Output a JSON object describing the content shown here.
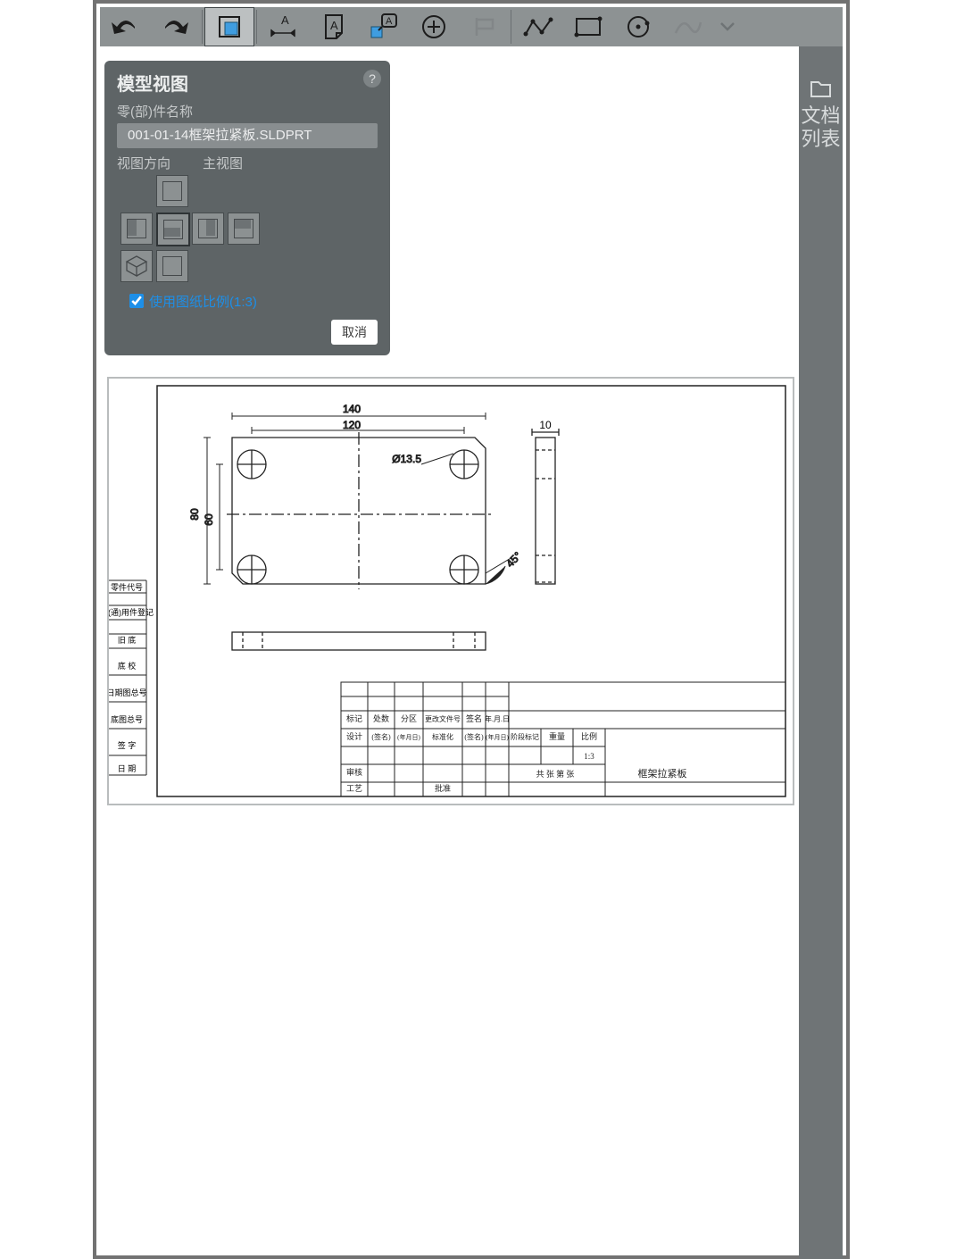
{
  "toolbar": {
    "icons": [
      "undo",
      "redo",
      "model-view",
      "linear-dim",
      "note-page",
      "balloon-note",
      "add-circle",
      "datum",
      "polyline",
      "rectangle",
      "circle",
      "spline",
      "chevron"
    ]
  },
  "right_rail": {
    "label": "文档列表"
  },
  "panel": {
    "title": "模型视图",
    "help": "?",
    "part_label": "零(部)件名称",
    "filename": "001-01-14框架拉紧板.SLDPRT",
    "orient_label": "视图方向",
    "main_label": "主视图",
    "checkbox_label": "使用图纸比例(1:3)",
    "cancel": "取消"
  },
  "drawing": {
    "dims": {
      "d140": "140",
      "d120": "120",
      "d10": "10",
      "d80": "80",
      "d60": "60",
      "diam": "Ø13.5",
      "ang": "45°"
    },
    "title_block": {
      "row1": [
        "标记",
        "处数",
        "分区",
        "更改文件号",
        "签名",
        "年.月.日"
      ],
      "row2": [
        "设计",
        "(签名)",
        "(年月日)",
        "标准化",
        "(签名)",
        "(年月日)"
      ],
      "row3_left": "审核",
      "row4_left": "工艺",
      "row4_right": "批准",
      "stage": "阶段标记",
      "weight": "重量",
      "scale": "比例",
      "scale_val": "1:3",
      "sheet": "共 张 第 张",
      "name": "框架拉紧板"
    },
    "side_labels": [
      "零件代号",
      "借(通)用件登记",
      "旧 底",
      "底 校",
      "日期图总号",
      "底图总号",
      "签 字",
      "日 期"
    ]
  }
}
